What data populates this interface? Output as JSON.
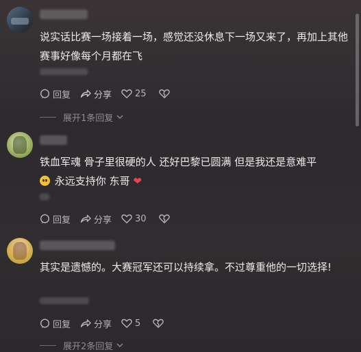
{
  "comments": [
    {
      "content": "说实话比赛一场接着一场，感觉还没休息下一场又来了，再加上其他赛事好像每个月都在飞",
      "reply_label": "回复",
      "share_label": "分享",
      "likes": "25",
      "expand_label": "展开1条回复"
    },
    {
      "content_a": "铁血军魂 骨子里很硬的人 还好巴黎已圆满 但是我还是意难平",
      "content_b": "永远支持你 东哥",
      "reply_label": "回复",
      "share_label": "分享",
      "likes": "30"
    },
    {
      "content": "其实是遗憾的。大赛冠军还可以持续拿。不过尊重他的一切选择!",
      "reply_label": "回复",
      "share_label": "分享",
      "likes": "5",
      "expand_label": "展开2条回复"
    }
  ]
}
